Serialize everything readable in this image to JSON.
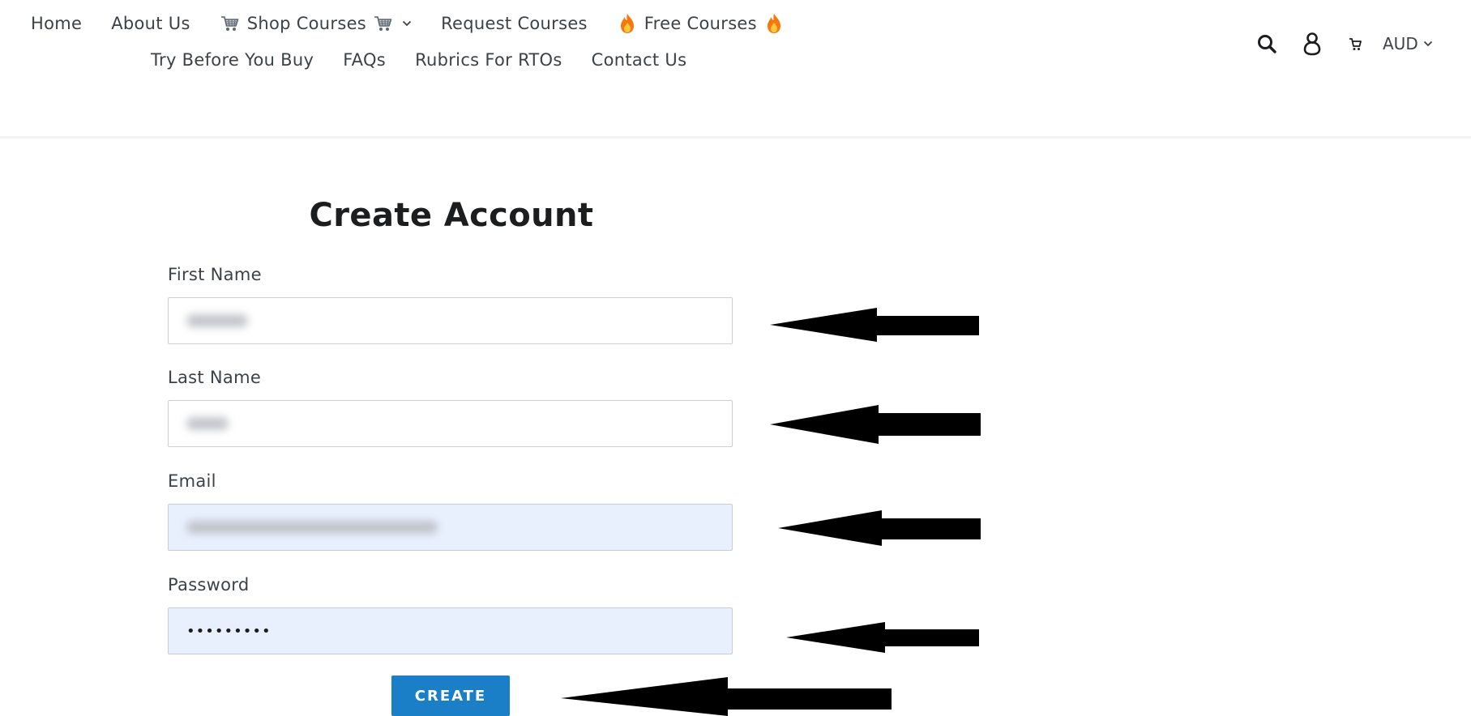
{
  "header": {
    "nav_row1": [
      {
        "label": "Home"
      },
      {
        "label": "About Us"
      },
      {
        "label": "Shop Courses",
        "icon_left": "shopping-cart-emoji",
        "icon_right": "shopping-cart-emoji",
        "has_dropdown": true
      },
      {
        "label": "Request Courses"
      },
      {
        "label": "Free Courses",
        "icon_left": "fire-emoji",
        "icon_right": "fire-emoji"
      }
    ],
    "nav_row2": [
      {
        "label": "Try Before You Buy"
      },
      {
        "label": "FAQs"
      },
      {
        "label": "Rubrics For RTOs"
      },
      {
        "label": "Contact Us"
      }
    ],
    "tools": {
      "search_icon": "search-icon",
      "account_icon": "account-icon",
      "cart_icon": "cart-icon",
      "currency": "AUD"
    }
  },
  "form": {
    "title": "Create Account",
    "fields": [
      {
        "label": "First Name",
        "value_state": "blurred",
        "autofilled": false
      },
      {
        "label": "Last Name",
        "value_state": "blurred",
        "autofilled": false
      },
      {
        "label": "Email",
        "value_state": "blurred",
        "autofilled": true
      },
      {
        "label": "Password",
        "value": "•••••••••",
        "autofilled": true
      }
    ],
    "submit_label": "CREATE"
  },
  "colors": {
    "text": "#3d4246",
    "title": "#1b1d1f",
    "button": "#1a7fc6",
    "autofill_bg": "#e8f0fe",
    "annotation_arrow": "#000000"
  }
}
